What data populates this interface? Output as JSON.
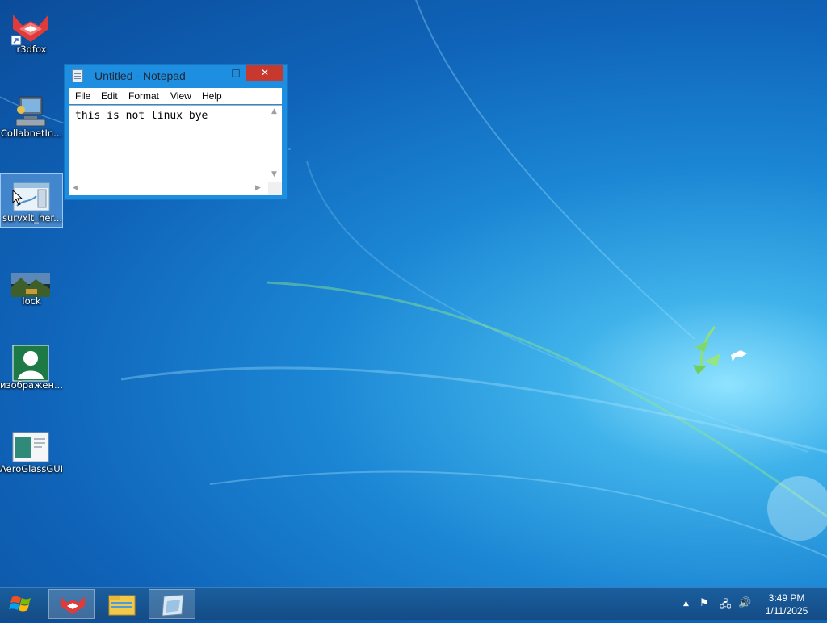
{
  "desktop": {
    "icons": [
      {
        "label": "r3dfox",
        "icon": "r3dfox-icon"
      },
      {
        "label": "CollabnetIn...",
        "icon": "computer-setup-icon"
      },
      {
        "label": "survxlt_her...",
        "icon": "window-app-icon"
      },
      {
        "label": "lock",
        "icon": "landscape-image-icon"
      },
      {
        "label": "изображен...",
        "icon": "user-image-icon"
      },
      {
        "label": "AeroGlassGUI",
        "icon": "aeroglass-app-icon"
      }
    ]
  },
  "notepad": {
    "title": "Untitled - Notepad",
    "menu": [
      "File",
      "Edit",
      "Format",
      "View",
      "Help"
    ],
    "content": "this is not linux bye",
    "minimize_glyph": "–",
    "maximize_glyph": "□",
    "close_glyph": "✕"
  },
  "taskbar": {
    "apps": [
      "r3dfox",
      "File Explorer",
      "Notepad"
    ],
    "tray": {
      "show_hidden": "▲",
      "flag": "⚑",
      "network": "🖧",
      "volume": "🔊"
    },
    "clock": {
      "time": "3:49 PM",
      "date": "1/11/2025"
    }
  },
  "colors": {
    "window_frame": "#1e8fe0",
    "close_button": "#c7392e",
    "taskbar": "#144c86"
  }
}
